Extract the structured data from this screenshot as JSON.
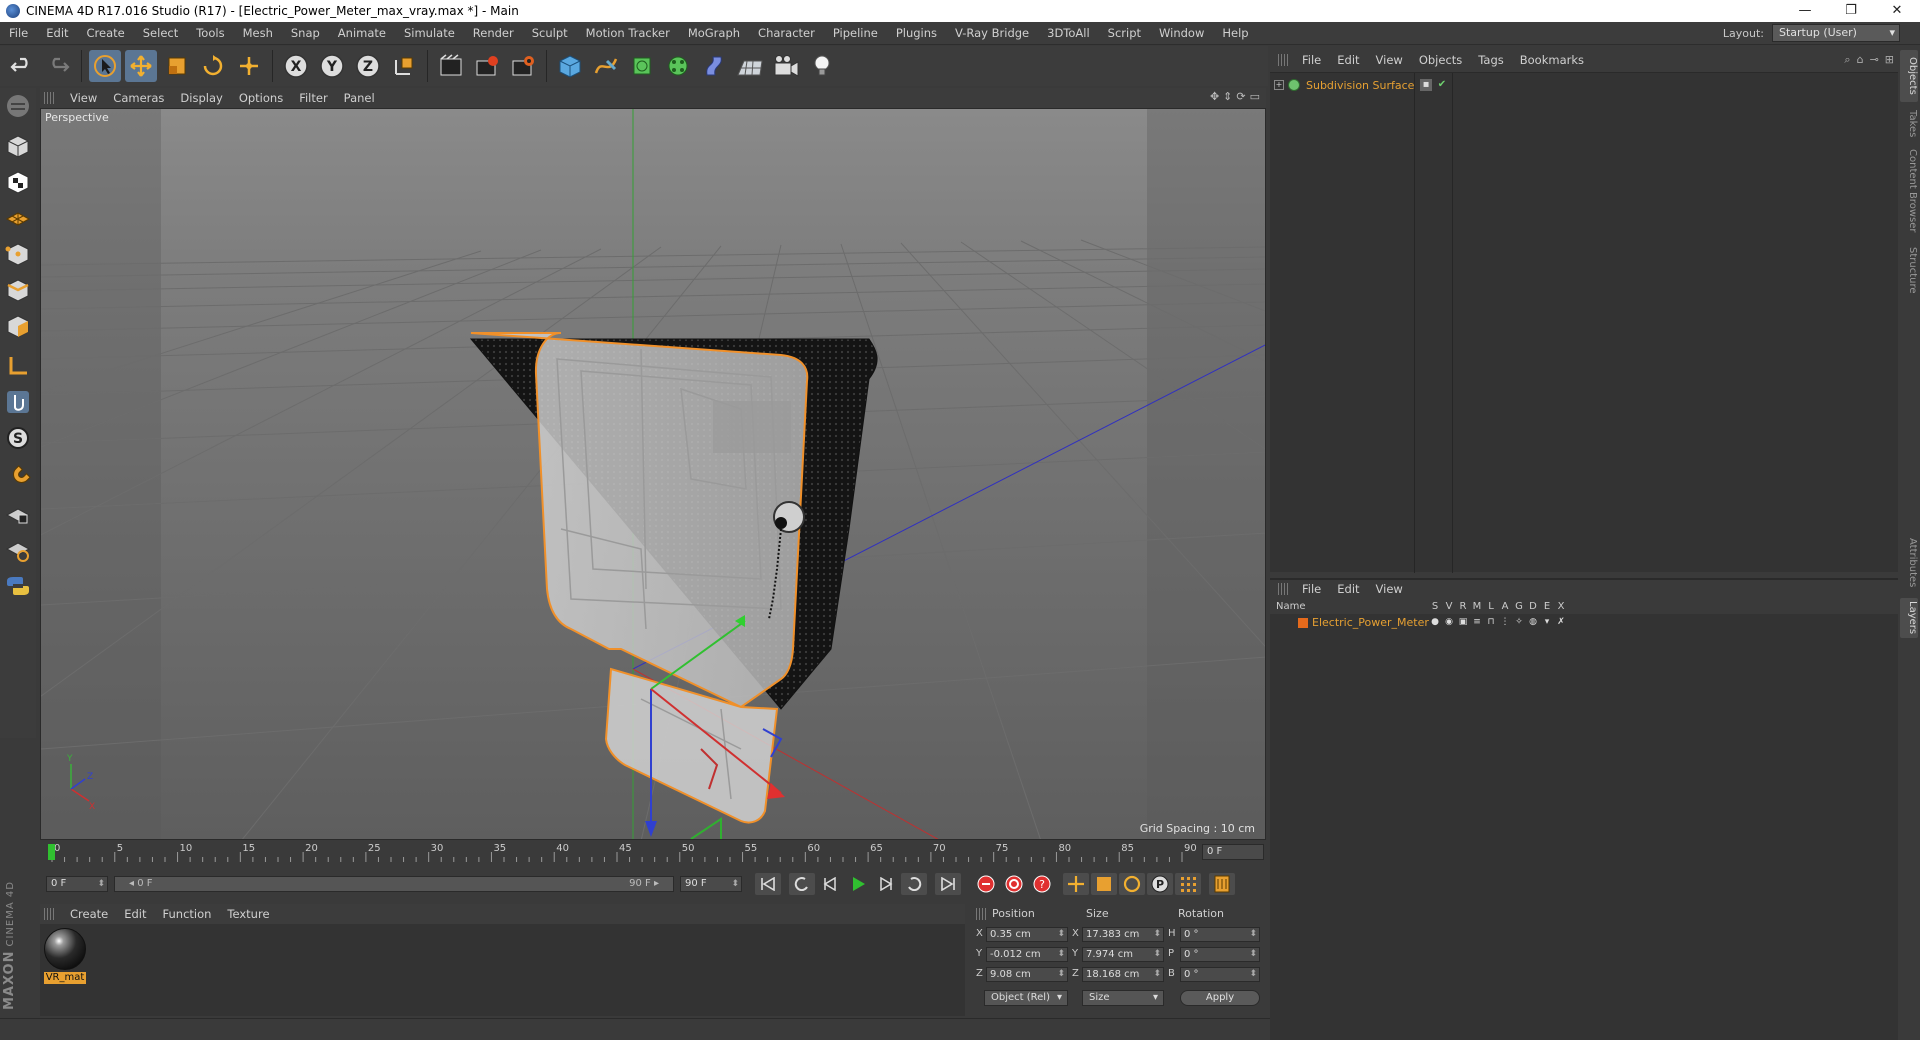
{
  "window": {
    "title": "CINEMA 4D R17.016 Studio (R17) - [Electric_Power_Meter_max_vray.max *] - Main",
    "minimize": "—",
    "maximize": "❐",
    "close": "✕"
  },
  "menubar": {
    "items": [
      "File",
      "Edit",
      "Create",
      "Select",
      "Tools",
      "Mesh",
      "Snap",
      "Animate",
      "Simulate",
      "Render",
      "Sculpt",
      "Motion Tracker",
      "MoGraph",
      "Character",
      "Pipeline",
      "Plugins",
      "V-Ray Bridge",
      "3DToAll",
      "Script",
      "Window",
      "Help"
    ],
    "layout_label": "Layout:",
    "layout_value": "Startup (User)"
  },
  "viewport": {
    "menus": [
      "View",
      "Cameras",
      "Display",
      "Options",
      "Filter",
      "Panel"
    ],
    "camera_label": "Perspective",
    "grid_spacing": "Grid Spacing : 10 cm"
  },
  "timeline": {
    "ticks": [
      "0",
      "5",
      "10",
      "15",
      "20",
      "25",
      "30",
      "35",
      "40",
      "45",
      "50",
      "55",
      "60",
      "65",
      "70",
      "75",
      "80",
      "85",
      "90"
    ],
    "current_frame": "0 F"
  },
  "transport": {
    "start_field": "0 F",
    "range_left": "◂ 0 F",
    "range_right": "90 F ▸",
    "end_field": "90 F"
  },
  "material_manager": {
    "menus": [
      "Create",
      "Edit",
      "Function",
      "Texture"
    ],
    "materials": [
      {
        "name": "VR_mat"
      }
    ]
  },
  "coordinates": {
    "headers": {
      "position": "Position",
      "size": "Size",
      "rotation": "Rotation"
    },
    "rows": [
      {
        "axis": "X",
        "position": "0.35 cm",
        "size_axis": "X",
        "size": "17.383 cm",
        "rot_axis": "H",
        "rotation": "0 °"
      },
      {
        "axis": "Y",
        "position": "-0.012 cm",
        "size_axis": "Y",
        "size": "7.974 cm",
        "rot_axis": "P",
        "rotation": "0 °"
      },
      {
        "axis": "Z",
        "position": "9.08 cm",
        "size_axis": "Z",
        "size": "18.168 cm",
        "rot_axis": "B",
        "rotation": "0 °"
      }
    ],
    "mode_dropdown": "Object (Rel)",
    "size_dropdown": "Size",
    "apply_label": "Apply"
  },
  "object_manager": {
    "menus": [
      "File",
      "Edit",
      "View",
      "Objects",
      "Tags",
      "Bookmarks"
    ],
    "objects": [
      {
        "name": "Subdivision Surface"
      }
    ]
  },
  "layer_manager": {
    "menus": [
      "File",
      "Edit",
      "View"
    ],
    "columns": [
      "Name",
      "S",
      "V",
      "R",
      "M",
      "L",
      "A",
      "G",
      "D",
      "E",
      "X"
    ],
    "layers": [
      {
        "name": "Electric_Power_Meter",
        "color": "#e56a1c"
      }
    ]
  },
  "side_tabs": [
    "Objects",
    "Takes",
    "Content Browser",
    "Structure",
    "Attributes",
    "Layers"
  ],
  "branding": {
    "logo": "MAXON",
    "product": "CINEMA 4D"
  },
  "colors": {
    "accent": "#e6a032",
    "selection_outline": "#f0902a",
    "active_tool": "#5b7694"
  }
}
